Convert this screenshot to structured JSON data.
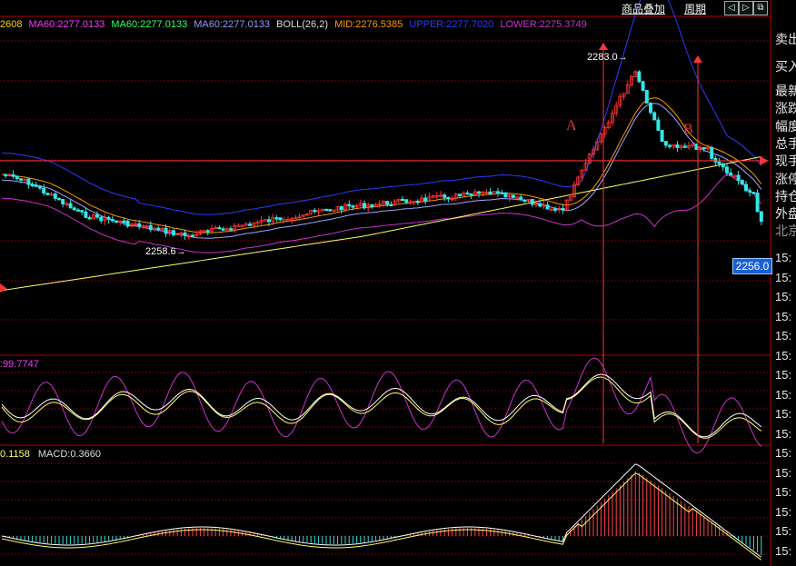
{
  "toolbar": {
    "overlay_label": "商品叠加",
    "period_label": "周期",
    "nav_icons": [
      "prev-icon",
      "next-icon",
      "restore-icon",
      "close-icon"
    ]
  },
  "legend": [
    {
      "text": "2608",
      "color": "#ffd700"
    },
    {
      "text": "MA60:2277.0133",
      "color": "#ff33ff"
    },
    {
      "text": "MA60:2277.0133",
      "color": "#33ff66"
    },
    {
      "text": "MA60:2277.0133",
      "color": "#9999ff"
    },
    {
      "text": "BOLL(26,2)",
      "color": "#dddddd"
    },
    {
      "text": "MID:2276.5385",
      "color": "#ff9900"
    },
    {
      "text": "UPPER:2277.7020",
      "color": "#2a3cff"
    },
    {
      "text": "LOWER:2275.3749",
      "color": "#cc33cc"
    }
  ],
  "annotations": {
    "high": "2283.0",
    "low": "2258.6",
    "mark_a": "A",
    "mark_b": "B"
  },
  "last_price": "2256.0",
  "indicator_kdj": {
    "text": ":99.7747",
    "color": "#ff33ff"
  },
  "indicator_macd": [
    {
      "text": "0.1158",
      "color": "#ffff66"
    },
    {
      "text": "MACD:0.3660",
      "color": "#dddddd"
    }
  ],
  "sidebar": {
    "labels": [
      "卖出",
      "买入",
      "最新",
      "涨跌",
      "幅度",
      "总手",
      "现手",
      "涨停",
      "持仓",
      "外盘",
      "北京"
    ],
    "times": [
      "15:",
      "15:",
      "15:",
      "15:",
      "15:",
      "15:",
      "15:",
      "15:",
      "15:",
      "15:",
      "15:",
      "15:",
      "15:",
      "15:",
      "15:",
      "15:"
    ]
  },
  "colors": {
    "up": "#ff3333",
    "down": "#33e6e6",
    "grid": "#6b0000"
  }
}
